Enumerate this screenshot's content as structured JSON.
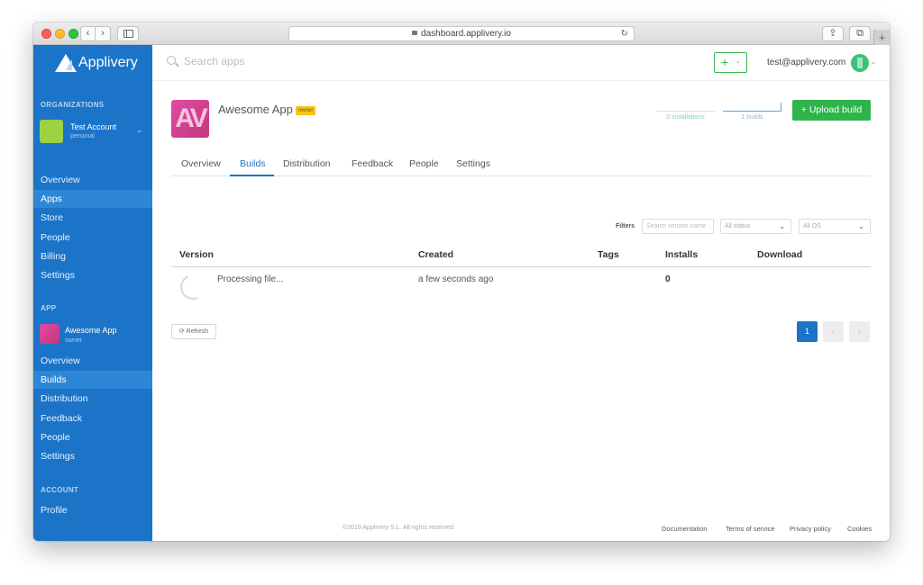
{
  "browser": {
    "url": "dashboard.applivery.io",
    "back_glyph": "‹",
    "forward_glyph": "›",
    "reload_glyph": "↻",
    "new_tab_glyph": "+"
  },
  "brand": {
    "name": "Applivery",
    "primary_color": "#1b74c8",
    "accent_green": "#2fb44b"
  },
  "sidebar": {
    "organizations_label": "ORGANIZATIONS",
    "account": {
      "name": "Test Account",
      "subtitle": "personal"
    },
    "org_items": [
      {
        "label": "Overview",
        "active": false
      },
      {
        "label": "Apps",
        "active": true
      },
      {
        "label": "Store",
        "active": false
      },
      {
        "label": "People",
        "active": false
      },
      {
        "label": "Billing",
        "active": false
      },
      {
        "label": "Settings",
        "active": false
      }
    ],
    "app_label": "APP",
    "app": {
      "name": "Awesome App",
      "role": "owner"
    },
    "app_items": [
      {
        "label": "Overview",
        "active": false
      },
      {
        "label": "Builds",
        "active": true
      },
      {
        "label": "Distribution",
        "active": false
      },
      {
        "label": "Feedback",
        "active": false
      },
      {
        "label": "People",
        "active": false
      },
      {
        "label": "Settings",
        "active": false
      }
    ],
    "account_label": "ACCOUNT",
    "account_items": [
      {
        "label": "Profile",
        "active": false
      }
    ]
  },
  "header": {
    "search_placeholder": "Search apps",
    "add_label": "+",
    "user_email": "test@applivery.com"
  },
  "app_header": {
    "icon_text": "AV",
    "title": "Awesome App",
    "badge": "owner",
    "stats": {
      "installations": "0 installations",
      "builds": "1 builds"
    },
    "upload_label": "+  Upload build"
  },
  "tabs": [
    {
      "label": "Overview",
      "active": false
    },
    {
      "label": "Builds",
      "active": true
    },
    {
      "label": "Distribution",
      "active": false
    },
    {
      "label": "Feedback",
      "active": false
    },
    {
      "label": "People",
      "active": false
    },
    {
      "label": "Settings",
      "active": false
    }
  ],
  "filters": {
    "label": "Filters",
    "search_placeholder": "Search version name",
    "status_value": "All status",
    "os_value": "All OS"
  },
  "table": {
    "columns": [
      "Version",
      "Created",
      "Tags",
      "Installs",
      "Download"
    ],
    "rows": [
      {
        "version": "Processing file...",
        "created": "a few seconds ago",
        "tags": "",
        "installs": "0",
        "download": ""
      }
    ]
  },
  "refresh_label": "⟳ Refresh",
  "pagination": {
    "current": "1",
    "prev": "‹",
    "next": "›"
  },
  "footer": {
    "copyright": "©2019 Applivery S.L. All rights reserved.",
    "links": [
      "Documentation",
      "Terms of service",
      "Privacy policy",
      "Cookies"
    ]
  }
}
